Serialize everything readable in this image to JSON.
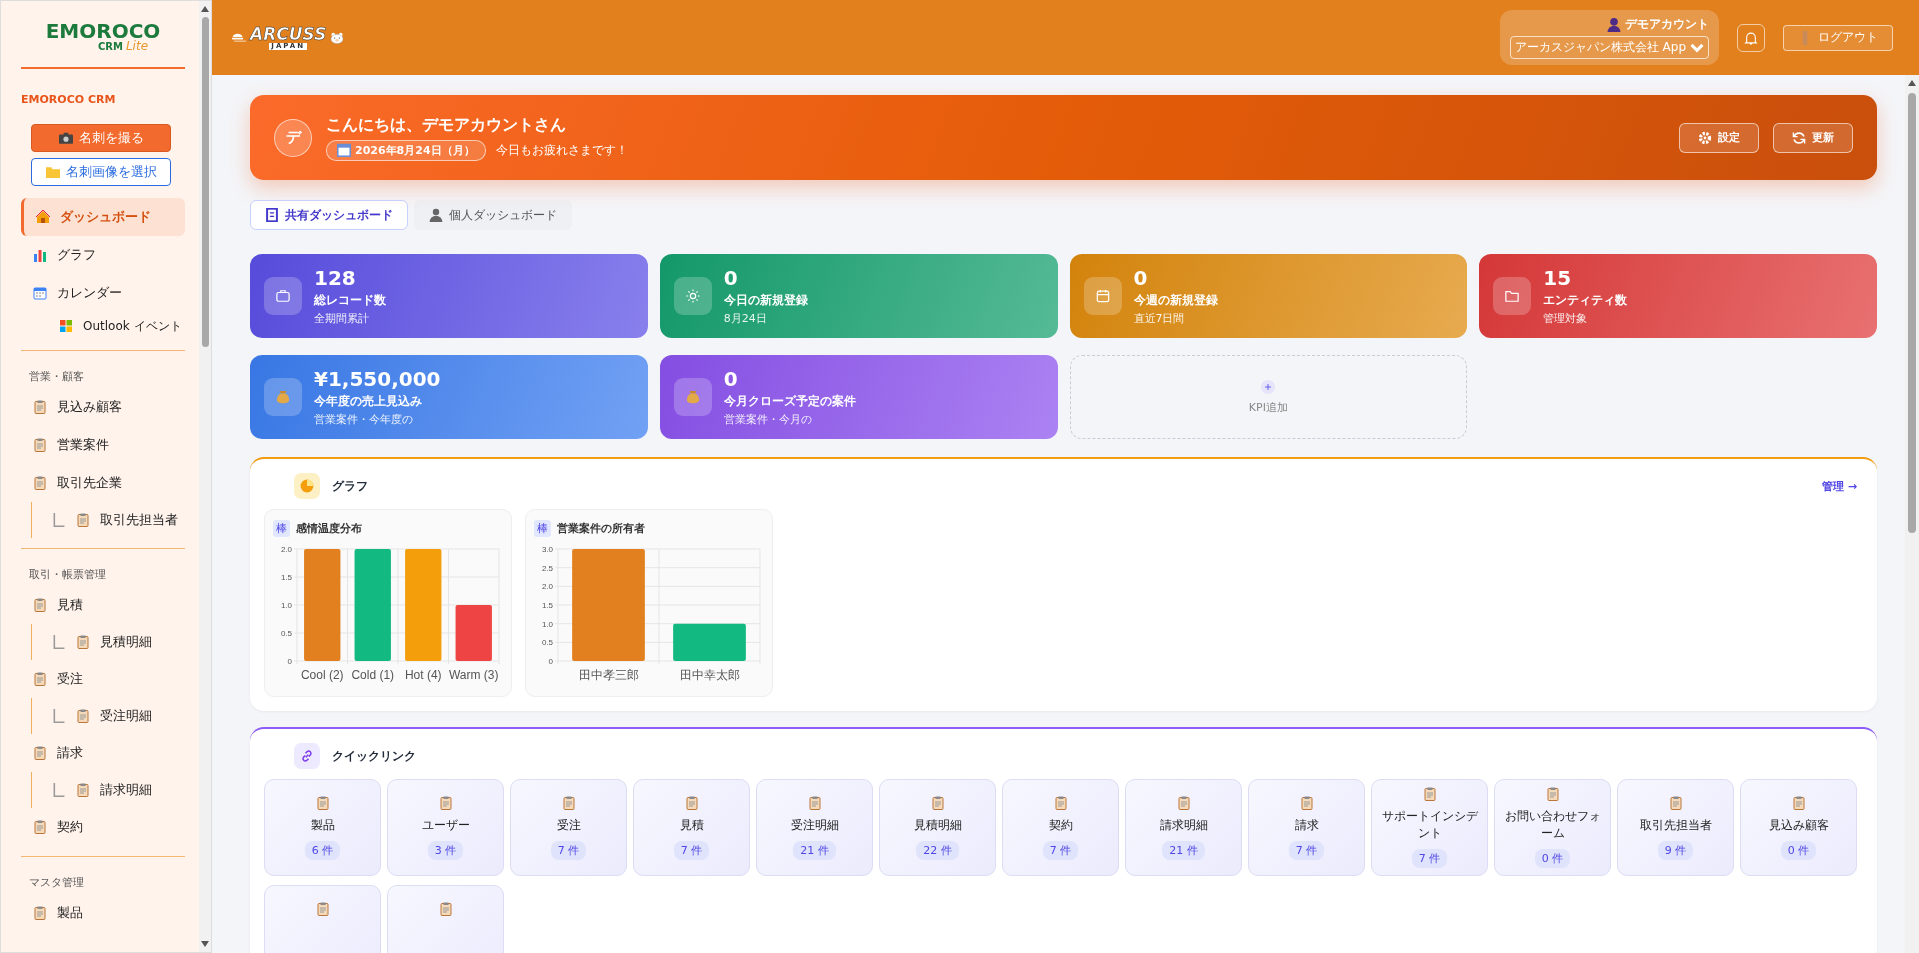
{
  "sidebar": {
    "logo": {
      "mark": "EMOROCO",
      "product": "CRM",
      "edition": "Lite"
    },
    "brand": "EMOROCO CRM",
    "buttons": [
      {
        "label": "名刺を撮る",
        "kind": "primary"
      },
      {
        "label": "名刺画像を選択",
        "kind": "outline"
      }
    ],
    "groups": [
      {
        "items": [
          {
            "label": "ダッシュボード",
            "kind": "home",
            "selected": true
          },
          {
            "label": "グラフ",
            "kind": "chart",
            "selected": false
          },
          {
            "label": "カレンダー",
            "kind": "calendar",
            "selected": false,
            "children": [
              {
                "label": "Outlook イベント",
                "kind": "outlook",
                "selected": false
              }
            ]
          }
        ]
      },
      {
        "heading": "営業・顧客",
        "items": [
          {
            "label": "見込み顧客",
            "kind": "record",
            "selected": false
          },
          {
            "label": "営業案件",
            "kind": "record",
            "selected": false
          },
          {
            "label": "取引先企業",
            "kind": "record",
            "selected": false,
            "children": [
              {
                "label": "取引先担当者",
                "kind": "record",
                "selected": false
              }
            ]
          }
        ]
      },
      {
        "heading": "取引・帳票管理",
        "items": [
          {
            "label": "見積",
            "kind": "record",
            "selected": false,
            "children": [
              {
                "label": "見積明細",
                "kind": "record",
                "selected": false
              }
            ]
          },
          {
            "label": "受注",
            "kind": "record",
            "selected": false,
            "children": [
              {
                "label": "受注明細",
                "kind": "record",
                "selected": false
              }
            ]
          },
          {
            "label": "請求",
            "kind": "record",
            "selected": false,
            "children": [
              {
                "label": "請求明細",
                "kind": "record",
                "selected": false
              }
            ]
          },
          {
            "label": "契約",
            "kind": "record",
            "selected": false
          }
        ]
      },
      {
        "heading": "マスタ管理",
        "items": [
          {
            "label": "製品",
            "kind": "record",
            "selected": false
          }
        ]
      }
    ]
  },
  "header": {
    "logo": {
      "mark": "ARCUSS",
      "sub": "JAPAN"
    },
    "user": "デモアカウント",
    "company": "アーカスジャパン株式会社 App",
    "logout": "ログアウト"
  },
  "hero": {
    "avatar": "デ",
    "greeting": "こんにちは、デモアカウントさん",
    "date": "2026年8月24日（月）",
    "message": "今日もお疲れさまです！",
    "buttons": [
      {
        "label": "設定",
        "kind": "settings"
      },
      {
        "label": "更新",
        "kind": "refresh"
      }
    ]
  },
  "tabs": [
    {
      "label": "共有ダッシュボード",
      "kind": "shared",
      "selected": true
    },
    {
      "label": "個人ダッシュボード",
      "kind": "personal",
      "selected": false
    }
  ],
  "kpis": [
    {
      "value": "128",
      "label": "総レコード数",
      "sub": "全期間累計",
      "kind": "briefcase",
      "color": "#5b4fe6"
    },
    {
      "value": "0",
      "label": "今日の新規登録",
      "sub": "8月24日",
      "kind": "sun",
      "color": "#14a06f"
    },
    {
      "value": "0",
      "label": "今週の新規登録",
      "sub": "直近7日間",
      "kind": "calendar",
      "color": "#de8a0c"
    },
    {
      "value": "15",
      "label": "エンティティ数",
      "sub": "管理対象",
      "kind": "folder",
      "color": "#e03a3a"
    },
    {
      "value": "¥1,550,000",
      "label": "今年度の売上見込み",
      "sub": "営業案件・今年度の",
      "kind": "money",
      "color": "#3b7df0"
    },
    {
      "value": "0",
      "label": "今月クローズ予定の案件",
      "sub": "営業案件・今月の",
      "kind": "money",
      "color": "#8b52ee"
    }
  ],
  "kpi_add": "KPI追加",
  "graphs": {
    "title": "グラフ",
    "manage": "管理 →",
    "charts": [
      {
        "badge": "棒",
        "chart_data": {
          "type": "bar",
          "title": "感情温度分布",
          "categories": [
            "Cool (2)",
            "Cold (1)",
            "Hot (4)",
            "Warm (3)"
          ],
          "series": [
            {
              "color": "#e27f1e",
              "values": [
                2,
                null,
                null,
                null
              ]
            },
            {
              "color": "#12b981",
              "values": [
                null,
                2,
                null,
                null
              ]
            },
            {
              "color": "#f59e0b",
              "values": [
                null,
                null,
                2,
                null
              ]
            },
            {
              "color": "#ef4444",
              "values": [
                null,
                null,
                null,
                1
              ]
            }
          ],
          "grid": true,
          "ylim": [
            0,
            2
          ],
          "yticks": [
            {
              "value": 0,
              "label": "0"
            },
            {
              "value": 0.5,
              "label": "0.5"
            },
            {
              "value": 1,
              "label": "1.0"
            },
            {
              "value": 1.5,
              "label": "1.5"
            },
            {
              "value": 2,
              "label": "2.0"
            }
          ]
        }
      },
      {
        "badge": "棒",
        "chart_data": {
          "type": "bar",
          "title": "営業案件の所有者",
          "categories": [
            "田中孝三郎",
            "田中幸太郎"
          ],
          "series": [
            {
              "color": "#e27f1e",
              "values": [
                3,
                null
              ]
            },
            {
              "color": "#12b981",
              "values": [
                null,
                1
              ]
            }
          ],
          "grid": true,
          "ylim": [
            0,
            3
          ],
          "yticks": [
            {
              "value": 0,
              "label": "0"
            },
            {
              "value": 0.5,
              "label": "0.5"
            },
            {
              "value": 1,
              "label": "1.0"
            },
            {
              "value": 1.5,
              "label": "1.5"
            },
            {
              "value": 2,
              "label": "2.0"
            },
            {
              "value": 2.5,
              "label": "2.5"
            },
            {
              "value": 3,
              "label": "3.0"
            }
          ]
        }
      }
    ]
  },
  "quick_links": {
    "title": "クイックリンク",
    "items": [
      {
        "label": "製品",
        "count": "6 件"
      },
      {
        "label": "ユーザー",
        "count": "3 件"
      },
      {
        "label": "受注",
        "count": "7 件"
      },
      {
        "label": "見積",
        "count": "7 件"
      },
      {
        "label": "受注明細",
        "count": "21 件"
      },
      {
        "label": "見積明細",
        "count": "22 件"
      },
      {
        "label": "契約",
        "count": "7 件"
      },
      {
        "label": "請求明細",
        "count": "21 件"
      },
      {
        "label": "請求",
        "count": "7 件"
      },
      {
        "label": "サポートインシデント",
        "count": "7 件"
      },
      {
        "label": "お問い合わせフォーム",
        "count": "0 件"
      },
      {
        "label": "取引先担当者",
        "count": "9 件"
      },
      {
        "label": "見込み顧客",
        "count": "0 件"
      },
      {
        "kind": "clipped"
      },
      {
        "kind": "clipped"
      }
    ]
  }
}
